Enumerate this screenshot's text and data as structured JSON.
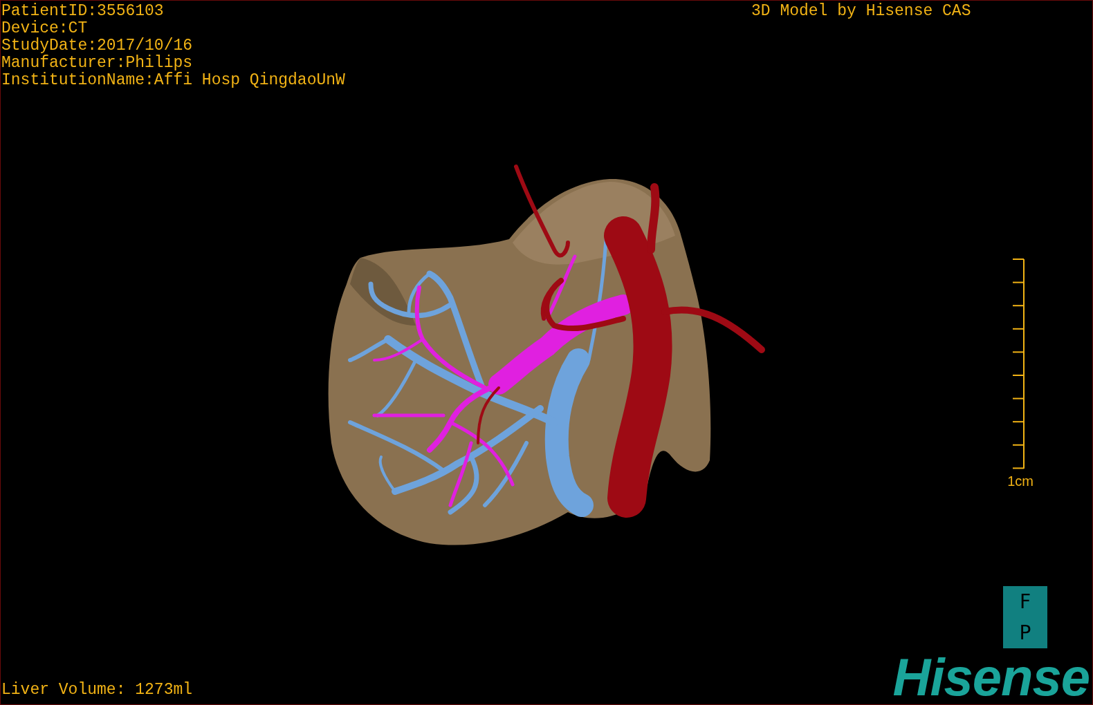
{
  "viewport": {
    "info_lines": [
      "PatientID:3556103",
      "Device:CT",
      "StudyDate:2017/10/16",
      "Manufacturer:Philips",
      "InstitutionName:Affi Hosp QingdaoUnW"
    ],
    "title": "3D Model by Hisense CAS",
    "scale_bar": {
      "label": "1cm"
    },
    "orientation": [
      "F",
      "P"
    ],
    "logo": "Hisense",
    "liver_volume": "Liver Volume: 1273ml"
  }
}
